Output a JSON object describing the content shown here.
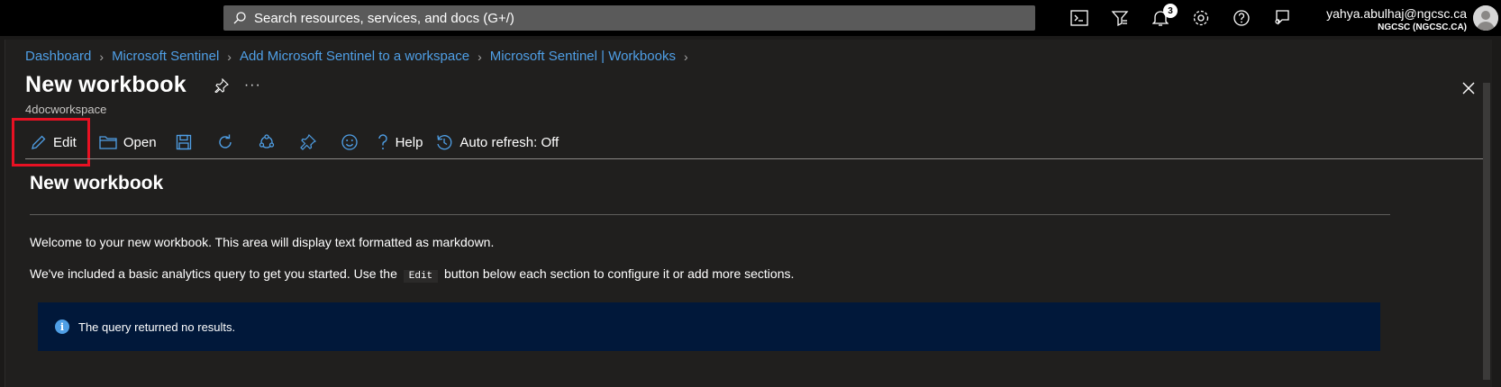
{
  "topbar": {
    "search_placeholder": "Search resources, services, and docs (G+/)",
    "icons": [
      "cloud-shell-icon",
      "directory-filter-icon",
      "notifications-icon",
      "settings-icon",
      "help-icon",
      "feedback-icon"
    ],
    "notification_count": "3",
    "account_email": "yahya.abulhaj@ngcsc.ca",
    "account_tenant": "NGCSC (NGCSC.CA)"
  },
  "breadcrumb": [
    "Dashboard",
    "Microsoft Sentinel",
    "Add Microsoft Sentinel to a workspace",
    "Microsoft Sentinel | Workbooks"
  ],
  "page": {
    "title": "New workbook",
    "more": "···",
    "subtitle": "4docworkspace"
  },
  "toolbar": {
    "edit_label": "Edit",
    "open_label": "Open",
    "help_label": "Help",
    "autorefresh_label": "Auto refresh: Off"
  },
  "workbook": {
    "heading": "New workbook",
    "para1": "Welcome to your new workbook. This area will display text formatted as markdown.",
    "para2_before": "We've included a basic analytics query to get you started. Use the",
    "para2_code": "Edit",
    "para2_after": "button below each section to configure it or add more sections.",
    "info_icon_text": "i",
    "info_message": "The query returned no results."
  },
  "colors": {
    "accent": "#4f9fe6",
    "highlight": "#e81123",
    "info_bg": "#01183a"
  }
}
